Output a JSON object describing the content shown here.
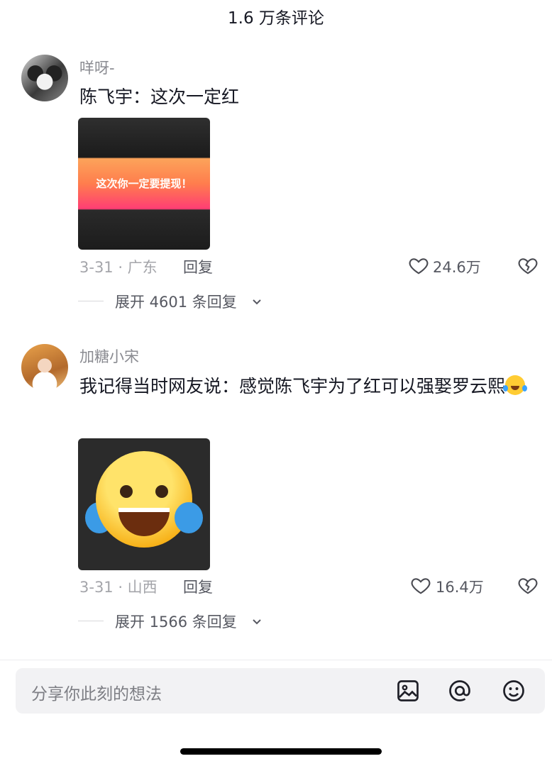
{
  "header": {
    "title": "1.6 万条评论"
  },
  "comments": [
    {
      "username": "咩呀-",
      "text": "陈飞宇：这次一定红",
      "image_caption": "这次你一定要提现！",
      "date_location": "3-31 · 广东",
      "reply_label": "回复",
      "likes": "24.6万",
      "expand_label": "展开 4601 条回复"
    },
    {
      "username": "加糖小宋",
      "text": "我记得当时网友说：感觉陈飞宇为了红可以强娶罗云熙",
      "date_location": "3-31 · 山西",
      "reply_label": "回复",
      "likes": "16.4万",
      "expand_label": "展开 1566 条回复"
    }
  ],
  "input": {
    "placeholder": "分享你此刻的想法"
  },
  "icons": {
    "image": "image-icon",
    "mention": "at-icon",
    "emoji": "smile-icon",
    "like": "heart-icon",
    "dislike": "broken-heart-icon",
    "expand": "chevron-down-icon"
  }
}
